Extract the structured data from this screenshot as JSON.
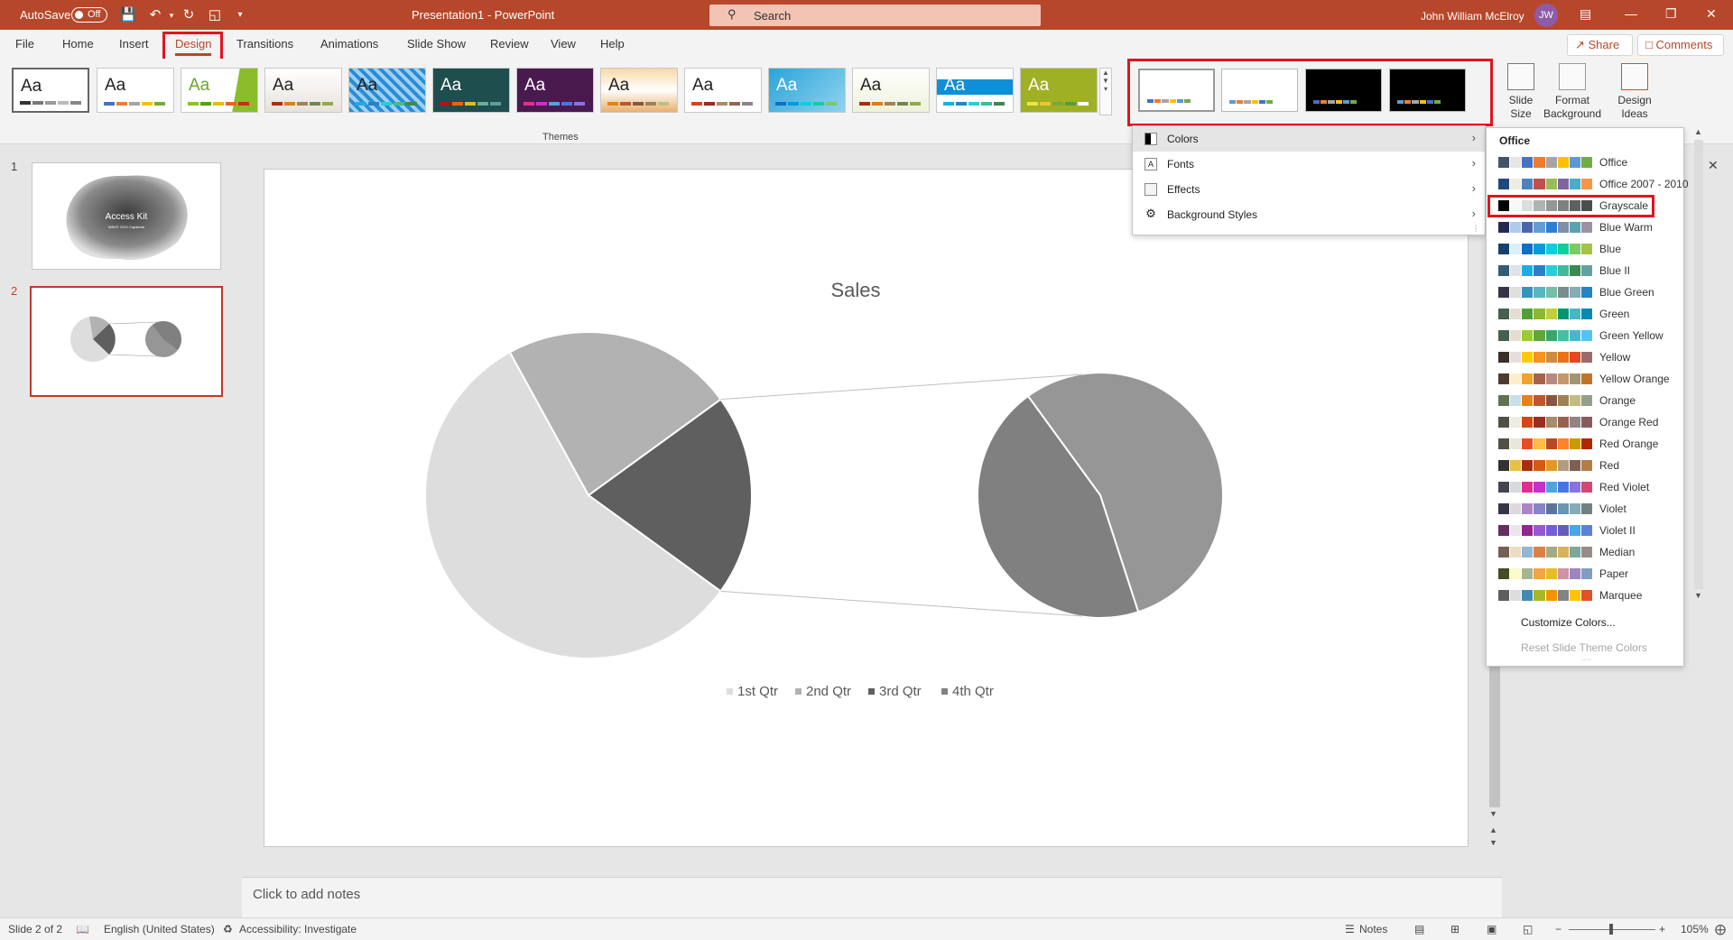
{
  "titlebar": {
    "autosave_label": "AutoSave",
    "autosave_state": "Off",
    "doc_title": "Presentation1  -  PowerPoint",
    "search_placeholder": "Search",
    "user_name": "John William McElroy",
    "user_initials": "JW"
  },
  "tabs": [
    "File",
    "Home",
    "Insert",
    "Design",
    "Transitions",
    "Animations",
    "Slide Show",
    "Review",
    "View",
    "Help"
  ],
  "active_tab": "Design",
  "share_label": "Share",
  "comments_label": "Comments",
  "ribbon": {
    "theme_aa": "Aa",
    "themes_group_label": "Themes",
    "slide_size_label": "Slide\nSize",
    "format_background_label": "Format\nBackground",
    "design_ideas_label": "Design\nIdeas"
  },
  "design_menu": {
    "items": [
      {
        "label": "Colors",
        "icon": "colors-icon"
      },
      {
        "label": "Fonts",
        "icon": "fonts-icon"
      },
      {
        "label": "Effects",
        "icon": "effects-icon"
      },
      {
        "label": "Background Styles",
        "icon": "background-styles-icon"
      }
    ]
  },
  "colors_menu": {
    "header": "Office",
    "schemes": [
      {
        "name": "Office",
        "colors": [
          "#44546a",
          "#e7e6e6",
          "#4472c4",
          "#ed7d31",
          "#a5a5a5",
          "#ffc000",
          "#5b9bd5",
          "#70ad47"
        ]
      },
      {
        "name": "Office 2007 - 2010",
        "colors": [
          "#1f497d",
          "#eeece1",
          "#4f81bd",
          "#c0504d",
          "#9bbb59",
          "#8064a2",
          "#4bacc6",
          "#f79646"
        ]
      },
      {
        "name": "Grayscale",
        "colors": [
          "#000000",
          "#f8f8f8",
          "#dddddd",
          "#b2b2b2",
          "#969696",
          "#808080",
          "#5f5f5f",
          "#4d4d4d"
        ]
      },
      {
        "name": "Blue Warm",
        "colors": [
          "#242852",
          "#acccea",
          "#4a66ac",
          "#629dd1",
          "#297fd5",
          "#7f8fa9",
          "#5aa2ae",
          "#9d90a0"
        ]
      },
      {
        "name": "Blue",
        "colors": [
          "#17406d",
          "#dbeff9",
          "#0f6fc6",
          "#009dd9",
          "#0bd0d9",
          "#10cf9b",
          "#7cca62",
          "#a5c249"
        ]
      },
      {
        "name": "Blue II",
        "colors": [
          "#335b74",
          "#dfe3e5",
          "#1cade4",
          "#2683c6",
          "#27ced7",
          "#42ba97",
          "#3e8853",
          "#62a39f"
        ]
      },
      {
        "name": "Blue Green",
        "colors": [
          "#373545",
          "#dedede",
          "#3494ba",
          "#58b6c0",
          "#75bda7",
          "#7a8c8e",
          "#84acb6",
          "#2683c6"
        ]
      },
      {
        "name": "Green",
        "colors": [
          "#455f51",
          "#e3ded1",
          "#549e39",
          "#8ab833",
          "#c0cf3a",
          "#029676",
          "#4ab5c4",
          "#0989b1"
        ]
      },
      {
        "name": "Green Yellow",
        "colors": [
          "#455f51",
          "#e3ded1",
          "#99cb38",
          "#63a537",
          "#37a76f",
          "#44c1a3",
          "#4eb3cf",
          "#51c3f9"
        ]
      },
      {
        "name": "Yellow",
        "colors": [
          "#39302a",
          "#e5dedb",
          "#ffca08",
          "#f8931d",
          "#ce8d3e",
          "#ec7016",
          "#e64823",
          "#9c6a6a"
        ]
      },
      {
        "name": "Yellow Orange",
        "colors": [
          "#4e3b30",
          "#fbeec9",
          "#f0a22e",
          "#a5644e",
          "#b58b80",
          "#c3986d",
          "#a19574",
          "#c17529"
        ]
      },
      {
        "name": "Orange",
        "colors": [
          "#637052",
          "#ccddea",
          "#e48312",
          "#bd582c",
          "#865640",
          "#9b8357",
          "#c2bc80",
          "#94a088"
        ]
      },
      {
        "name": "Orange Red",
        "colors": [
          "#505046",
          "#eeece1",
          "#d34817",
          "#9b2d1f",
          "#a28e6a",
          "#956251",
          "#918485",
          "#855d5d"
        ]
      },
      {
        "name": "Red Orange",
        "colors": [
          "#505046",
          "#e8e7dc",
          "#e84c22",
          "#ffbd47",
          "#b64926",
          "#ff8427",
          "#cc9900",
          "#b22600"
        ]
      },
      {
        "name": "Red",
        "colors": [
          "#323232",
          "#e5c243",
          "#a5300f",
          "#d55816",
          "#e19825",
          "#b19c7d",
          "#7f5f52",
          "#b27d49"
        ]
      },
      {
        "name": "Red Violet",
        "colors": [
          "#454551",
          "#d8d9dc",
          "#e32d91",
          "#c830cc",
          "#4ea6dc",
          "#4775e7",
          "#8971e1",
          "#d54773"
        ]
      },
      {
        "name": "Violet",
        "colors": [
          "#373545",
          "#dcd8dc",
          "#ad84c6",
          "#8784c7",
          "#5d739a",
          "#6997af",
          "#84acb6",
          "#6f8183"
        ]
      },
      {
        "name": "Violet II",
        "colors": [
          "#632e62",
          "#eae5eb",
          "#92278f",
          "#9b57d3",
          "#755dd9",
          "#665eb8",
          "#45a5ed",
          "#5982db"
        ]
      },
      {
        "name": "Median",
        "colors": [
          "#775f55",
          "#ebddc3",
          "#94b6d2",
          "#dd8047",
          "#a5ab81",
          "#d8b25c",
          "#7ba79d",
          "#968c8c"
        ]
      },
      {
        "name": "Paper",
        "colors": [
          "#444d26",
          "#fefac9",
          "#a5b592",
          "#f3a447",
          "#e7bc29",
          "#d092a7",
          "#9c85c0",
          "#809ec2"
        ]
      },
      {
        "name": "Marquee",
        "colors": [
          "#5e5e5e",
          "#ddddde",
          "#418ab3",
          "#a6b727",
          "#f69200",
          "#838383",
          "#fec306",
          "#df5327"
        ]
      }
    ],
    "customize_label": "Customize Colors...",
    "reset_label": "Reset Slide Theme Colors"
  },
  "slides_pane": {
    "slide1_num": "1",
    "slide1_title": "Access Kit",
    "slide1_subtitle": "WAVIT 2021 Capstone",
    "slide2_num": "2"
  },
  "notes_placeholder": "Click to add notes",
  "statusbar": {
    "slide_of": "Slide 2 of 2",
    "language": "English (United States)",
    "accessibility": "Accessibility: Investigate",
    "notes_label": "Notes",
    "zoom": "105%"
  },
  "chart_data": {
    "type": "pie",
    "title": "Sales",
    "subtype": "pie-of-pie",
    "categories": [
      "1st Qtr",
      "2nd Qtr",
      "3rd Qtr",
      "4th Qtr"
    ],
    "colors": [
      "#dddddd",
      "#b2b2b2",
      "#5f5f5f",
      "#808080"
    ],
    "primary_slices_fraction": [
      0.57,
      0.23,
      0.2
    ],
    "secondary_slices_fraction": [
      0.55,
      0.45
    ],
    "legend": "bottom"
  }
}
